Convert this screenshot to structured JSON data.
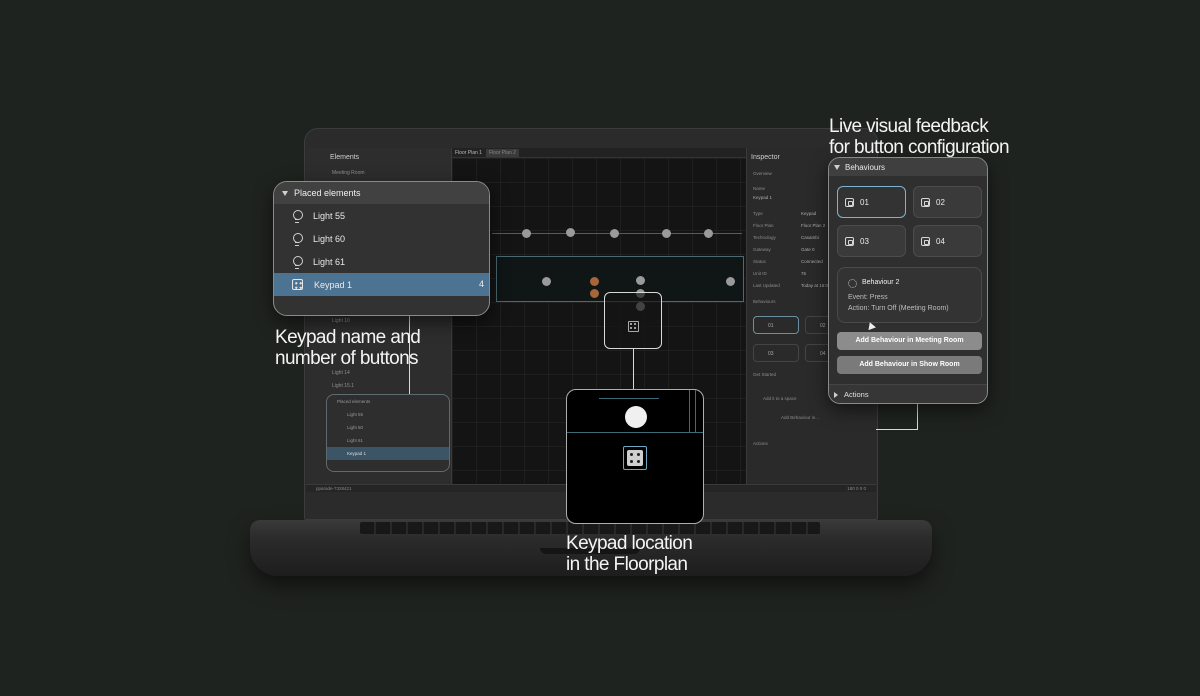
{
  "captions": {
    "live_feedback": [
      "Live visual feedback",
      "for button configuration"
    ],
    "keypad_name": [
      "Keypad name and",
      "number of buttons"
    ],
    "keypad_location": [
      "Keypad location",
      "in the Floorplan"
    ]
  },
  "screen": {
    "left_title": "Elements",
    "left_rows": [
      "Meeting Room",
      "Light 10",
      "Light 14",
      "Light 15.1"
    ],
    "tabs": [
      "Floor Plan 1",
      "Floor Plan 2"
    ],
    "inspector_title": "Inspector",
    "overview_label": "Overview",
    "inspector_rows": [
      {
        "label": "Name",
        "value": "Keypad 1"
      },
      {
        "label": "Type",
        "value": "Keypad"
      },
      {
        "label": "Floor Plan",
        "value": "Floor Plan 2"
      },
      {
        "label": "Technology",
        "value": "Casambi"
      },
      {
        "label": "Gateway",
        "value": "Gate 0"
      },
      {
        "label": "Status",
        "value": "Connected"
      },
      {
        "label": "Unit ID",
        "value": "76"
      },
      {
        "label": "Last Updated",
        "value": "Today at 16:0"
      }
    ],
    "behaviours_label": "Behaviours",
    "mini_buttons": [
      "01",
      "02",
      "03",
      "04"
    ],
    "get_started": "Get Started",
    "add_to_space": "Add it to a space",
    "add_behaviour": "Add Behaviour in...",
    "actions_label": "Actions",
    "status_left": "pparade-7328421",
    "status_right": "180 0 0 0",
    "mini_placed_header": "Placed elements",
    "mini_placed_items": [
      "Light 55",
      "Light 60",
      "Light 61",
      "Keypad 1"
    ]
  },
  "placed_elements": {
    "header": "Placed elements",
    "items": [
      {
        "label": "Light 55",
        "icon": "lightbulb-icon"
      },
      {
        "label": "Light 60",
        "icon": "lightbulb-icon"
      },
      {
        "label": "Light 61",
        "icon": "lightbulb-icon"
      },
      {
        "label": "Keypad 1",
        "icon": "keypad-icon",
        "count": "4",
        "selected": true
      }
    ]
  },
  "behaviours": {
    "header": "Behaviours",
    "buttons": [
      {
        "label": "01",
        "selected": true
      },
      {
        "label": "02",
        "selected": false
      },
      {
        "label": "03",
        "selected": false
      },
      {
        "label": "04",
        "selected": false
      }
    ],
    "detail": {
      "title": "Behaviour 2",
      "event": "Event: Press",
      "action": "Action: Turn Off (Meeting Room)"
    },
    "add_buttons": [
      "Add Behaviour in Meeting Room",
      "Add Behaviour in Show Room"
    ],
    "actions_label": "Actions"
  },
  "colors": {
    "background": "#1f231f",
    "selected_row": "#4d7392",
    "selected_button_border": "#7fb2cf",
    "floorplan_wall": "#3f6a78"
  }
}
